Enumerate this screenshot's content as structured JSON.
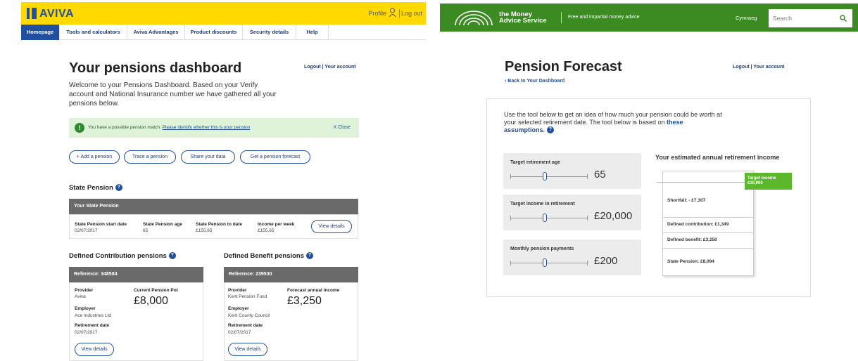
{
  "aviva": {
    "brand": "AVIVA",
    "profile_label": "Profile",
    "logout_label": "Log out",
    "nav_tabs": [
      {
        "label": "Homepage",
        "active": true
      },
      {
        "label": "Tools and calculators",
        "active": false
      },
      {
        "label": "Aviva Advantages",
        "active": false
      },
      {
        "label": "Product discounts",
        "active": false
      },
      {
        "label": "Security details",
        "active": false
      },
      {
        "label": "Help",
        "active": false
      }
    ],
    "page_title": "Your pensions dashboard",
    "account_links": "Logout | Your account",
    "welcome_text": "Welcome to your Pensions Dashboard. Based on your Verify account and National Insurance number we have gathered all your pensions below.",
    "alert": {
      "icon": "!",
      "text": "You have a possible pension match.",
      "link": "Please identify whether this is your pension",
      "close": "X Close"
    },
    "actions": [
      "+ Add a pension",
      "Trace a pension",
      "Share your data",
      "Get a pension forecast"
    ],
    "state_pension": {
      "heading": "State Pension",
      "bar_title": "Your State Pension",
      "columns": [
        {
          "label": "State Pension start date",
          "value": "02/07/2017"
        },
        {
          "label": "State Pension age",
          "value": "65"
        },
        {
          "label": "State Pension to date",
          "value": "£155.65"
        },
        {
          "label": "Income per week",
          "value": "£155.65"
        }
      ],
      "view_details": "View details"
    },
    "dc": {
      "heading": "Defined Contribution pensions",
      "reference": "Reference: 348584",
      "provider_label": "Provider",
      "provider": "Aviva",
      "pot_label": "Current Pension Pot",
      "pot_value": "£8,000",
      "employer_label": "Employer",
      "employer": "Ace Industries Ltd",
      "retirement_label": "Retirement date",
      "retirement_date": "02/07/2017",
      "view_details": "View details"
    },
    "db": {
      "heading": "Defined Benefit pensions",
      "reference": "Reference: 239530",
      "provider_label": "Provider",
      "provider": "Kent Pension Fund",
      "income_label": "Forecast annual income",
      "income_value": "£3,250",
      "employer_label": "Employer",
      "employer": "Kent County Council",
      "retirement_label": "Retirement date",
      "retirement_date": "02/07/2017",
      "view_details": "View details"
    }
  },
  "mas": {
    "brand_line1": "the Money",
    "brand_line2": "Advice Service",
    "tagline": "Free and impartial money advice",
    "language_link": "Cymraeg",
    "search_placeholder": "Search",
    "page_title": "Pension Forecast",
    "back_link": "‹ Back to Your Dashboard",
    "account_links": "Logout | Your account",
    "intro_text": "Use the tool below to get an idea of how much your pension could be worth at your selected retirement date. The tool below is based on",
    "intro_link": "these assumptions.",
    "sliders": [
      {
        "label": "Target retirement age",
        "value": "65"
      },
      {
        "label": "Target income in retirement",
        "value": "£20,000"
      },
      {
        "label": "Monthly pension payments",
        "value": "£200"
      }
    ],
    "estimate": {
      "title": "Your estimated annual retirement income",
      "target_label": "Target income",
      "target_value": "£20,000",
      "rows": [
        "Shortfall: - £7,307",
        "Defined contribution: £1,349",
        "Defined benefit: £3,250",
        "State Pension: £8,094"
      ]
    },
    "colors": {
      "green": "#3b8b22",
      "accent_green": "#5bb82a",
      "link_blue": "#1f4f9e"
    }
  }
}
